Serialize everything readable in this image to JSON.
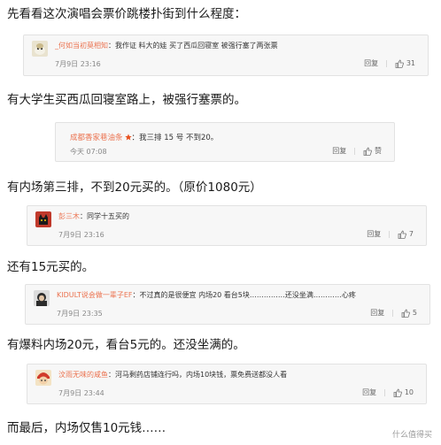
{
  "captions": [
    "先看看这次演唱会票价跳楼扑街到什么程度：",
    "有大学生买西瓜回寝室路上，被强行塞票的。",
    "有内场第三排，不到20元买的。（原价1080元）",
    "还有15元买的。",
    "有爆料内场20元，看台5元的。还没坐满的。",
    "而最后，内场仅售10元钱……"
  ],
  "comments": [
    {
      "username": "_何如当初莫相知",
      "text": "：我作证 料大的娃 买了西瓜回寝室 被强行塞了两张票",
      "time": "7月9日 23:16",
      "reply": "回复",
      "likes": "31"
    },
    {
      "username": "成都香家巷油条",
      "text": "：我三排 15 号 不到20。",
      "time": "今天 07:08",
      "reply": "回复",
      "likes": "赞"
    },
    {
      "username": "彭三木",
      "text": "：同学十五买的",
      "time": "7月9日 23:16",
      "reply": "回复",
      "likes": "7"
    },
    {
      "username": "KIDULT说会做一辈子EF",
      "text": "：不过真的是很便宜 内场20 看台5块……………还没坐满…………心疼",
      "time": "7月9日 23:35",
      "reply": "回复",
      "likes": "5"
    },
    {
      "username": "汶雨无味的咸鱼",
      "text": "：河马剩药店铺连行吗，内场10块钱，票免费送都没人看",
      "time": "7月9日 23:44",
      "reply": "回复",
      "likes": "10"
    }
  ],
  "watermark": "什么值得买"
}
